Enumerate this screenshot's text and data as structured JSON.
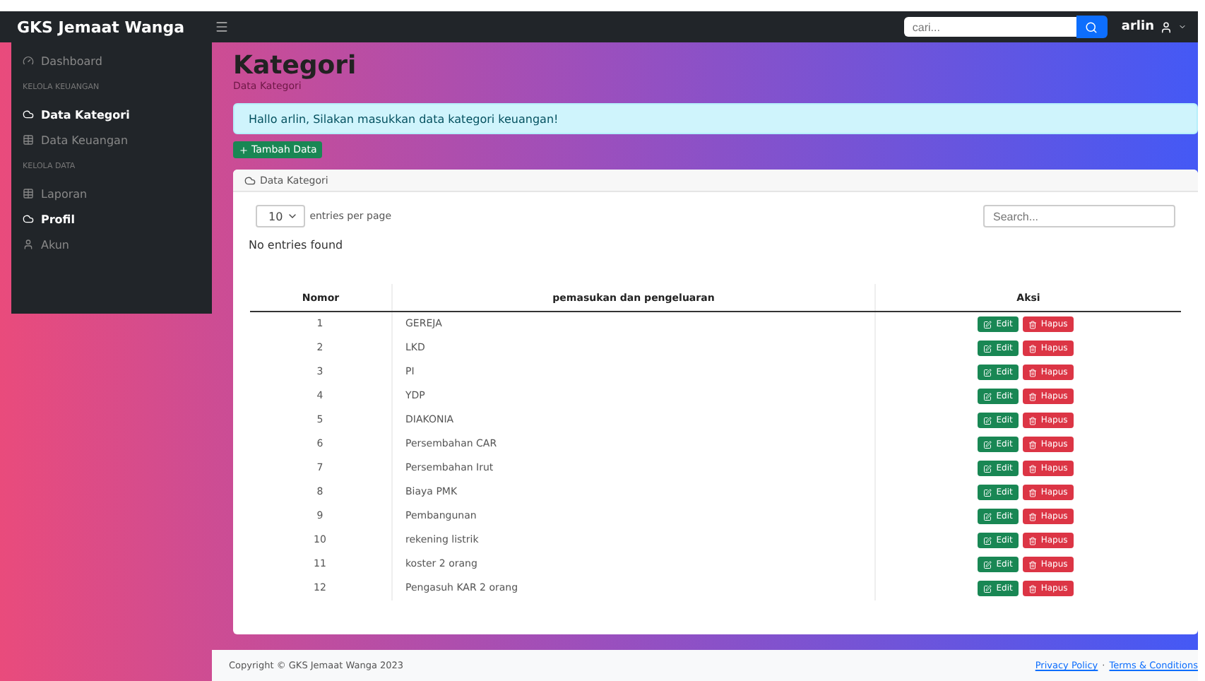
{
  "brand": "GKS Jemaat Wanga",
  "topbar": {
    "search_placeholder": "cari...",
    "user": "arlin"
  },
  "sidebar": {
    "items": [
      {
        "kind": "link",
        "label": "Dashboard",
        "selected": false
      },
      {
        "kind": "heading",
        "label": "KELOLA KEUANGAN"
      },
      {
        "kind": "link",
        "label": "Data Kategori",
        "selected": true
      },
      {
        "kind": "link",
        "label": "Data Keuangan",
        "selected": false
      },
      {
        "kind": "heading",
        "label": "KELOLA DATA"
      },
      {
        "kind": "link",
        "label": "Laporan",
        "selected": false
      },
      {
        "kind": "link",
        "label": "Profil",
        "selected": true
      },
      {
        "kind": "link",
        "label": "Akun",
        "selected": false
      }
    ]
  },
  "page": {
    "title": "Kategori",
    "subtitle": "Data Kategori",
    "alert": "Hallo arlin, Silakan masukkan data kategori keuangan!",
    "add_button": "Tambah Data"
  },
  "card": {
    "title": "Data Kategori",
    "page_size": "10",
    "entries_label": "entries per page",
    "search_placeholder": "Search...",
    "empty_message": "No entries found",
    "table": {
      "columns": [
        "Nomor",
        "pemasukan dan pengeluaran",
        "Aksi"
      ],
      "rows": [
        {
          "number": "1",
          "name": "GEREJA",
          "edit": "Edit",
          "delete": "Hapus"
        },
        {
          "number": "2",
          "name": "LKD",
          "edit": "Edit",
          "delete": "Hapus"
        },
        {
          "number": "3",
          "name": "PI",
          "edit": "Edit",
          "delete": "Hapus"
        },
        {
          "number": "4",
          "name": "YDP",
          "edit": "Edit",
          "delete": "Hapus"
        },
        {
          "number": "5",
          "name": "DIAKONIA",
          "edit": "Edit",
          "delete": "Hapus"
        },
        {
          "number": "6",
          "name": "Persembahan CAR",
          "edit": "Edit",
          "delete": "Hapus"
        },
        {
          "number": "7",
          "name": "Persembahan Irut",
          "edit": "Edit",
          "delete": "Hapus"
        },
        {
          "number": "8",
          "name": "Biaya PMK",
          "edit": "Edit",
          "delete": "Hapus"
        },
        {
          "number": "9",
          "name": "Pembangunan",
          "edit": "Edit",
          "delete": "Hapus"
        },
        {
          "number": "10",
          "name": "rekening listrik",
          "edit": "Edit",
          "delete": "Hapus"
        },
        {
          "number": "11",
          "name": "koster 2 orang",
          "edit": "Edit",
          "delete": "Hapus"
        },
        {
          "number": "12",
          "name": "Pengasuh KAR 2 orang",
          "edit": "Edit",
          "delete": "Hapus"
        }
      ]
    }
  },
  "footer": {
    "copyright": "Copyright © GKS Jemaat Wanga 2023",
    "links": [
      "Privacy Policy",
      "Terms & Conditions"
    ],
    "separator": "·"
  }
}
